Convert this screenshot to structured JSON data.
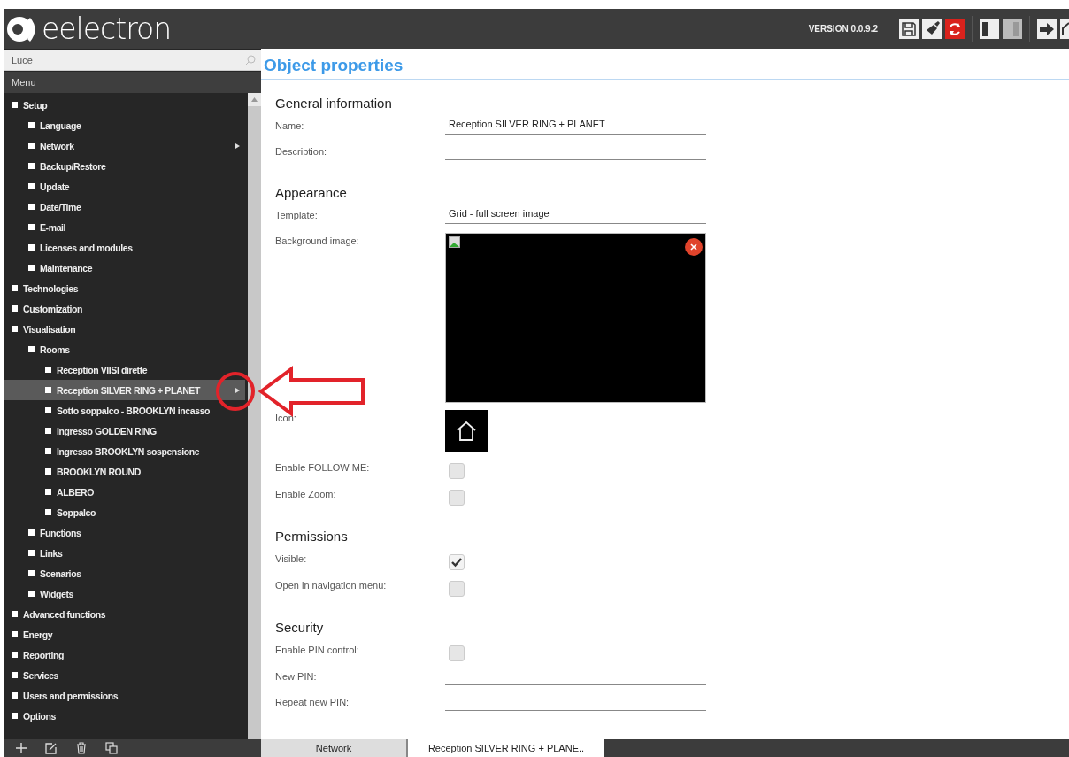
{
  "header": {
    "logo": "eelectron",
    "version": "VERSION 0.0.9.2"
  },
  "sidebar": {
    "search": {
      "value": "Luce"
    },
    "menu_title": "Menu",
    "items": [
      {
        "label": "Setup",
        "selected": false,
        "has_submenu": false,
        "children": [
          {
            "label": "Language",
            "selected": false,
            "has_submenu": false
          },
          {
            "label": "Network",
            "selected": false,
            "has_submenu": true
          },
          {
            "label": "Backup/Restore",
            "selected": false,
            "has_submenu": false
          },
          {
            "label": "Update",
            "selected": false,
            "has_submenu": false
          },
          {
            "label": "Date/Time",
            "selected": false,
            "has_submenu": false
          },
          {
            "label": "E-mail",
            "selected": false,
            "has_submenu": false
          },
          {
            "label": "Licenses and modules",
            "selected": false,
            "has_submenu": false
          },
          {
            "label": "Maintenance",
            "selected": false,
            "has_submenu": false
          }
        ]
      },
      {
        "label": "Technologies",
        "selected": false,
        "has_submenu": false
      },
      {
        "label": "Customization",
        "selected": false,
        "has_submenu": false
      },
      {
        "label": "Visualisation",
        "selected": false,
        "has_submenu": false,
        "children": [
          {
            "label": "Rooms",
            "selected": false,
            "has_submenu": false,
            "children": [
              {
                "label": "Reception VIISI dirette",
                "selected": false,
                "has_submenu": false
              },
              {
                "label": "Reception SILVER RING + PLANET",
                "selected": true,
                "has_submenu": true
              },
              {
                "label": "Sotto soppalco - BROOKLYN incasso",
                "selected": false,
                "has_submenu": false
              },
              {
                "label": "Ingresso GOLDEN RING",
                "selected": false,
                "has_submenu": false
              },
              {
                "label": "Ingresso BROOKLYN sospensione",
                "selected": false,
                "has_submenu": false
              },
              {
                "label": "BROOKLYN ROUND",
                "selected": false,
                "has_submenu": false
              },
              {
                "label": "ALBERO",
                "selected": false,
                "has_submenu": false
              },
              {
                "label": "Soppalco",
                "selected": false,
                "has_submenu": false
              }
            ]
          },
          {
            "label": "Functions",
            "selected": false,
            "has_submenu": false
          },
          {
            "label": "Links",
            "selected": false,
            "has_submenu": false
          },
          {
            "label": "Scenarios",
            "selected": false,
            "has_submenu": false
          },
          {
            "label": "Widgets",
            "selected": false,
            "has_submenu": false
          }
        ]
      },
      {
        "label": "Advanced functions",
        "selected": false,
        "has_submenu": false
      },
      {
        "label": "Energy",
        "selected": false,
        "has_submenu": false
      },
      {
        "label": "Reporting",
        "selected": false,
        "has_submenu": false
      },
      {
        "label": "Services",
        "selected": false,
        "has_submenu": false
      },
      {
        "label": "Users and permissions",
        "selected": false,
        "has_submenu": false
      },
      {
        "label": "Options",
        "selected": false,
        "has_submenu": false
      }
    ]
  },
  "content": {
    "title": "Object properties",
    "sections": [
      {
        "title": "General information",
        "fields": [
          {
            "kind": "text",
            "label": "Name:",
            "value": "Reception SILVER RING + PLANET"
          },
          {
            "kind": "text",
            "label": "Description:"
          }
        ]
      },
      {
        "title": "Appearance",
        "fields": [
          {
            "kind": "text",
            "label": "Template:",
            "value": "Grid - full screen image"
          },
          {
            "kind": "image",
            "label": "Background image:"
          },
          {
            "kind": "icon",
            "label": "Icon:"
          },
          {
            "kind": "checkbox",
            "label": "Enable FOLLOW ME:",
            "checked": false
          },
          {
            "kind": "checkbox",
            "label": "Enable Zoom:",
            "checked": false
          }
        ]
      },
      {
        "title": "Permissions",
        "fields": [
          {
            "kind": "checkbox",
            "label": "Visible:",
            "checked": true
          },
          {
            "kind": "checkbox",
            "label": "Open in navigation menu:",
            "checked": false
          }
        ]
      },
      {
        "title": "Security",
        "fields": [
          {
            "kind": "checkbox",
            "label": "Enable PIN control:",
            "checked": false
          },
          {
            "kind": "text",
            "label": "New PIN:"
          },
          {
            "kind": "text",
            "label": "Repeat new PIN:"
          }
        ]
      }
    ]
  },
  "tabs": [
    {
      "label": "Network",
      "selected": false
    },
    {
      "label": "Reception SILVER RING + PLANE..",
      "selected": true
    }
  ]
}
